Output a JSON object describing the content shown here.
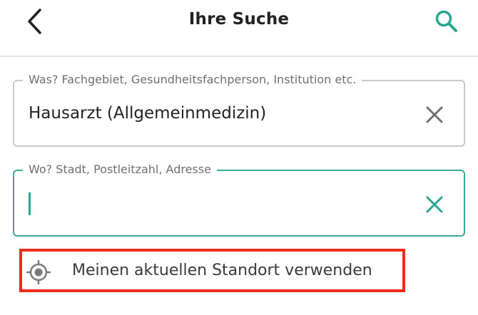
{
  "header": {
    "title": "Ihre Suche",
    "back_icon": "chevron-left-icon",
    "search_icon": "search-icon",
    "accent_color": "#2aa58f"
  },
  "what_field": {
    "label": "Was? Fachgebiet, Gesundheitsfachperson, Institution etc.",
    "value": "Hausarzt (Allgemeinmedizin)",
    "clear_icon": "close-icon"
  },
  "where_field": {
    "label": "Wo? Stadt, Postleitzahl, Adresse",
    "value": "",
    "clear_icon": "close-icon",
    "focused": true
  },
  "location_action": {
    "label": "Meinen aktuellen Standort verwenden",
    "icon": "crosshair-location-icon",
    "highlight_color": "#ee2a1b"
  }
}
